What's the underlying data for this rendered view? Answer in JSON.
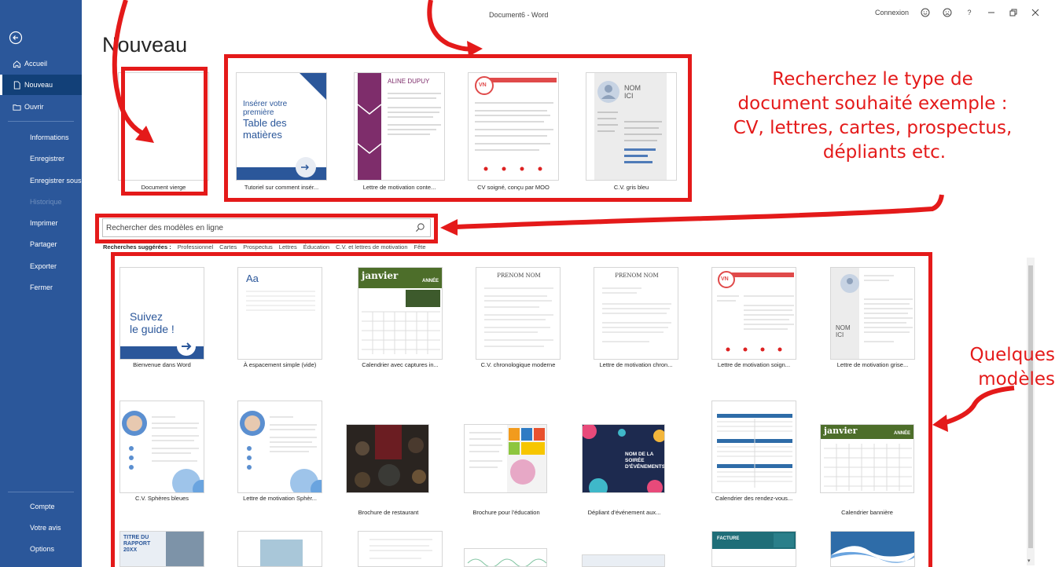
{
  "window": {
    "title": "Document6 - Word",
    "signin": "Connexion",
    "help": "?"
  },
  "sidebar": {
    "items": [
      {
        "label": "Accueil",
        "icon": "home-icon"
      },
      {
        "label": "Nouveau",
        "icon": "new-document-icon",
        "active": true
      },
      {
        "label": "Ouvrir",
        "icon": "open-folder-icon"
      },
      {
        "label": "Informations"
      },
      {
        "label": "Enregistrer"
      },
      {
        "label": "Enregistrer sous"
      },
      {
        "label": "Historique",
        "disabled": true
      },
      {
        "label": "Imprimer"
      },
      {
        "label": "Partager"
      },
      {
        "label": "Exporter"
      },
      {
        "label": "Fermer"
      },
      {
        "label": "Compte"
      },
      {
        "label": "Votre avis"
      },
      {
        "label": "Options"
      }
    ]
  },
  "page": {
    "title": "Nouveau"
  },
  "top_templates": [
    {
      "label": "Document vierge"
    },
    {
      "label": "Tutoriel sur comment insér...",
      "thumb_line1": "Insérer votre",
      "thumb_line2": "première",
      "thumb_line3": "Table des",
      "thumb_line4": "matières"
    },
    {
      "label": "Lettre de motivation conte...",
      "thumb_name": "ALINE DUPUY"
    },
    {
      "label": "CV soigné, conçu par MOO",
      "thumb_badge": "VN"
    },
    {
      "label": "C.V. gris bleu",
      "thumb_name1": "NOM",
      "thumb_name2": "ICI"
    }
  ],
  "search": {
    "placeholder": "Rechercher des modèles en ligne"
  },
  "suggestions": {
    "label": "Recherches suggérées :",
    "items": [
      "Professionnel",
      "Cartes",
      "Prospectus",
      "Lettres",
      "Éducation",
      "C.V. et lettres de motivation",
      "Fête"
    ]
  },
  "grid_templates": [
    {
      "label": "Bienvenue dans Word",
      "thumb_line1": "Suivez",
      "thumb_line2": "le guide !"
    },
    {
      "label": "À espacement simple (vide)",
      "thumb_text": "Aa"
    },
    {
      "label": "Calendrier avec captures in...",
      "thumb_month": "janvier",
      "thumb_year": "ANNÉE"
    },
    {
      "label": "C.V. chronologique moderne",
      "thumb_name": "PRENOM NOM"
    },
    {
      "label": "Lettre de motivation chron...",
      "thumb_name": "PRENOM NOM"
    },
    {
      "label": "Lettre de motivation soign...",
      "thumb_badge": "VN"
    },
    {
      "label": "Lettre de motivation grise...",
      "thumb_name1": "NOM",
      "thumb_name2": "ICI"
    },
    {
      "label": "C.V. Sphères bleues"
    },
    {
      "label": "Lettre de motivation Sphèr..."
    },
    {
      "label": "Brochure de restaurant"
    },
    {
      "label": "Brochure pour l'éducation"
    },
    {
      "label": "Dépliant d'événement aux...",
      "thumb_line1": "NOM DE LA",
      "thumb_line2": "SOIRÉE",
      "thumb_line3": "D'ÉVÉNEMENTS"
    },
    {
      "label": "Calendrier des rendez-vous..."
    },
    {
      "label": "Calendrier bannière",
      "thumb_month": "janvier",
      "thumb_year": "ANNÉE"
    }
  ],
  "bottom_partial": [
    {
      "thumb_line1": "TITRE DU",
      "thumb_line2": "RAPPORT",
      "thumb_line3": "20XX"
    },
    {
      "thumb_text": "FACTURE"
    }
  ],
  "annotations": {
    "callout_search_lines": [
      "Recherchez le type de",
      "document souhaité exemple :",
      "CV, lettres, cartes, prospectus,",
      "dépliants etc."
    ],
    "callout_models_lines": [
      "Quelques",
      "modèles"
    ]
  },
  "colors": {
    "sidebar": "#2b579a",
    "annotation": "#e41a1a",
    "word_blue": "#2b579a"
  }
}
